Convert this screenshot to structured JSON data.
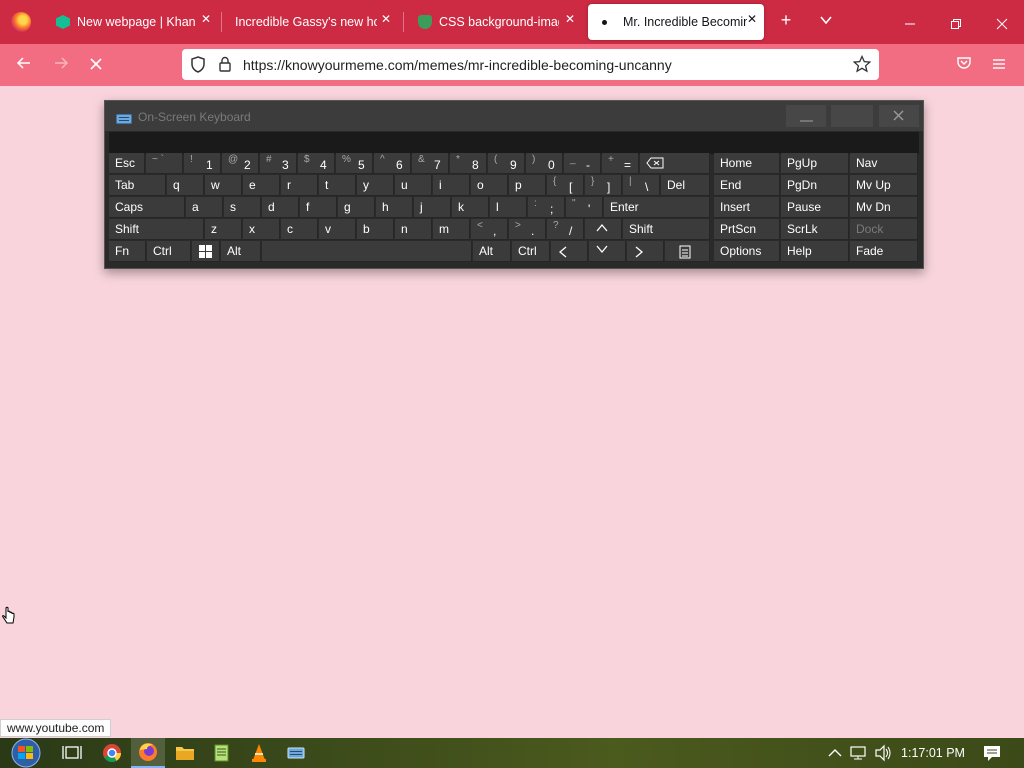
{
  "browser": {
    "tabs": [
      {
        "title": "New webpage | Khan A",
        "icon": "khan-academy-icon",
        "active": false
      },
      {
        "title": "Incredible Gassy's new hom",
        "icon": "",
        "active": false
      },
      {
        "title": "CSS background-image",
        "icon": "css-tricks-icon",
        "active": false
      },
      {
        "title": "Mr. Incredible Becomin",
        "icon": "loading-dot-icon",
        "active": true
      }
    ],
    "new_tab_symbol": "+",
    "url": "https://knowyourmeme.com/memes/mr-incredible-becoming-uncanny",
    "status_link": "www.youtube.com",
    "theme": {
      "tabbar": "#cd2b43",
      "navbar": "#f36d82",
      "content": "#f9d4dc"
    }
  },
  "osk": {
    "title": "On-Screen Keyboard",
    "rows": [
      [
        {
          "shift": "~ `",
          "main": ""
        },
        {
          "shift": "!",
          "main": "1"
        },
        {
          "shift": "@",
          "main": "2"
        },
        {
          "shift": "#",
          "main": "3"
        },
        {
          "shift": "$",
          "main": "4"
        },
        {
          "shift": "%",
          "main": "5"
        },
        {
          "shift": "^",
          "main": "6"
        },
        {
          "shift": "&",
          "main": "7"
        },
        {
          "shift": "*",
          "main": "8"
        },
        {
          "shift": "(",
          "main": "9"
        },
        {
          "shift": ")",
          "main": "0"
        },
        {
          "shift": "_",
          "main": "-"
        },
        {
          "shift": "+",
          "main": "="
        }
      ],
      [
        "q",
        "w",
        "e",
        "r",
        "t",
        "y",
        "u",
        "i",
        "o",
        "p"
      ],
      [
        "a",
        "s",
        "d",
        "f",
        "g",
        "h",
        "j",
        "k",
        "l"
      ],
      [
        "z",
        "x",
        "c",
        "v",
        "b",
        "n",
        "m"
      ]
    ],
    "row1_right": [
      {
        "shift": "{",
        "main": "["
      },
      {
        "shift": "}",
        "main": "]"
      },
      {
        "shift": "|",
        "main": "\\"
      }
    ],
    "row2_right": [
      {
        "shift": ":",
        "main": ";"
      },
      {
        "shift": "\"",
        "main": "'"
      }
    ],
    "row3_right": [
      {
        "shift": "<",
        "main": ","
      },
      {
        "shift": ">",
        "main": "."
      },
      {
        "shift": "?",
        "main": "/"
      }
    ],
    "labels": {
      "esc": "Esc",
      "tab": "Tab",
      "caps": "Caps",
      "shift": "Shift",
      "fn": "Fn",
      "ctrl": "Ctrl",
      "alt": "Alt",
      "del": "Del",
      "enter": "Enter",
      "shift_r": "Shift",
      "alt_r": "Alt",
      "ctrl_r": "Ctrl",
      "home": "Home",
      "pgup": "PgUp",
      "nav": "Nav",
      "end": "End",
      "pgdn": "PgDn",
      "mvup": "Mv Up",
      "insert": "Insert",
      "pause": "Pause",
      "mvdn": "Mv Dn",
      "prtscn": "PrtScn",
      "scrlk": "ScrLk",
      "dock": "Dock",
      "options": "Options",
      "help": "Help",
      "fade": "Fade"
    }
  },
  "taskbar": {
    "clock": "1:17:01 PM"
  }
}
